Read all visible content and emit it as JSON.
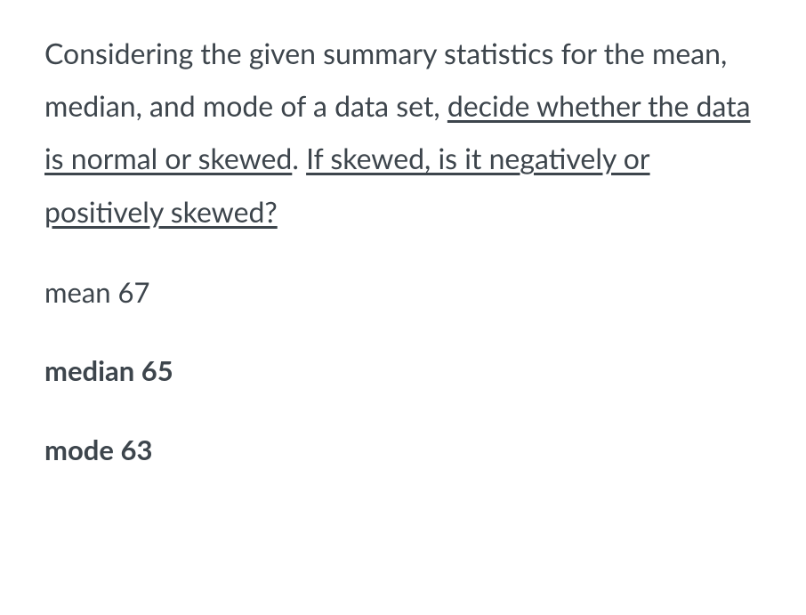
{
  "question": {
    "intro": "Considering the given summary statistics for the  mean, median, and mode of a data set, ",
    "underlined_part1": "decide whether the data is normal or skewed",
    "separator": ". ",
    "underlined_part2": "If skewed, is it negatively or positively skewed?"
  },
  "stats": {
    "mean": {
      "label": "mean",
      "value": "67"
    },
    "median": {
      "label": "median",
      "value": "65"
    },
    "mode": {
      "label": "mode",
      "value": "63"
    }
  }
}
